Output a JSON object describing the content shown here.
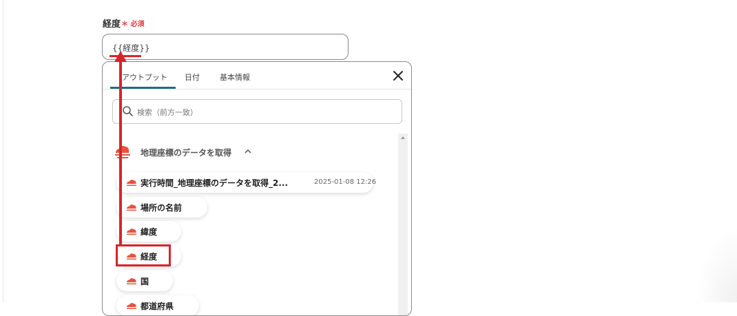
{
  "field": {
    "label": "経度",
    "required": "＊ 必須",
    "value": "{{経度}}"
  },
  "panel": {
    "tabs": [
      "アウトプット",
      "日付",
      "基本情報"
    ],
    "active_tab": 0,
    "search_placeholder": "検索（前方一致）",
    "group": {
      "title": "地理座標のデータを取得",
      "icon": "cloud-icon",
      "expanded": true
    },
    "items": [
      {
        "label": "実行時間_地理座標のデータを取得_2...",
        "date": "2025-01-08 12:26"
      },
      {
        "label": "場所の名前",
        "date": ""
      },
      {
        "label": "緯度",
        "date": ""
      },
      {
        "label": "経度",
        "date": ""
      },
      {
        "label": "国",
        "date": ""
      },
      {
        "label": "都道府県",
        "date": ""
      }
    ]
  },
  "colors": {
    "accent": "#1f6f7c",
    "annotation": "#d9232a",
    "icon": "#e8533f",
    "required": "#e8383d"
  }
}
